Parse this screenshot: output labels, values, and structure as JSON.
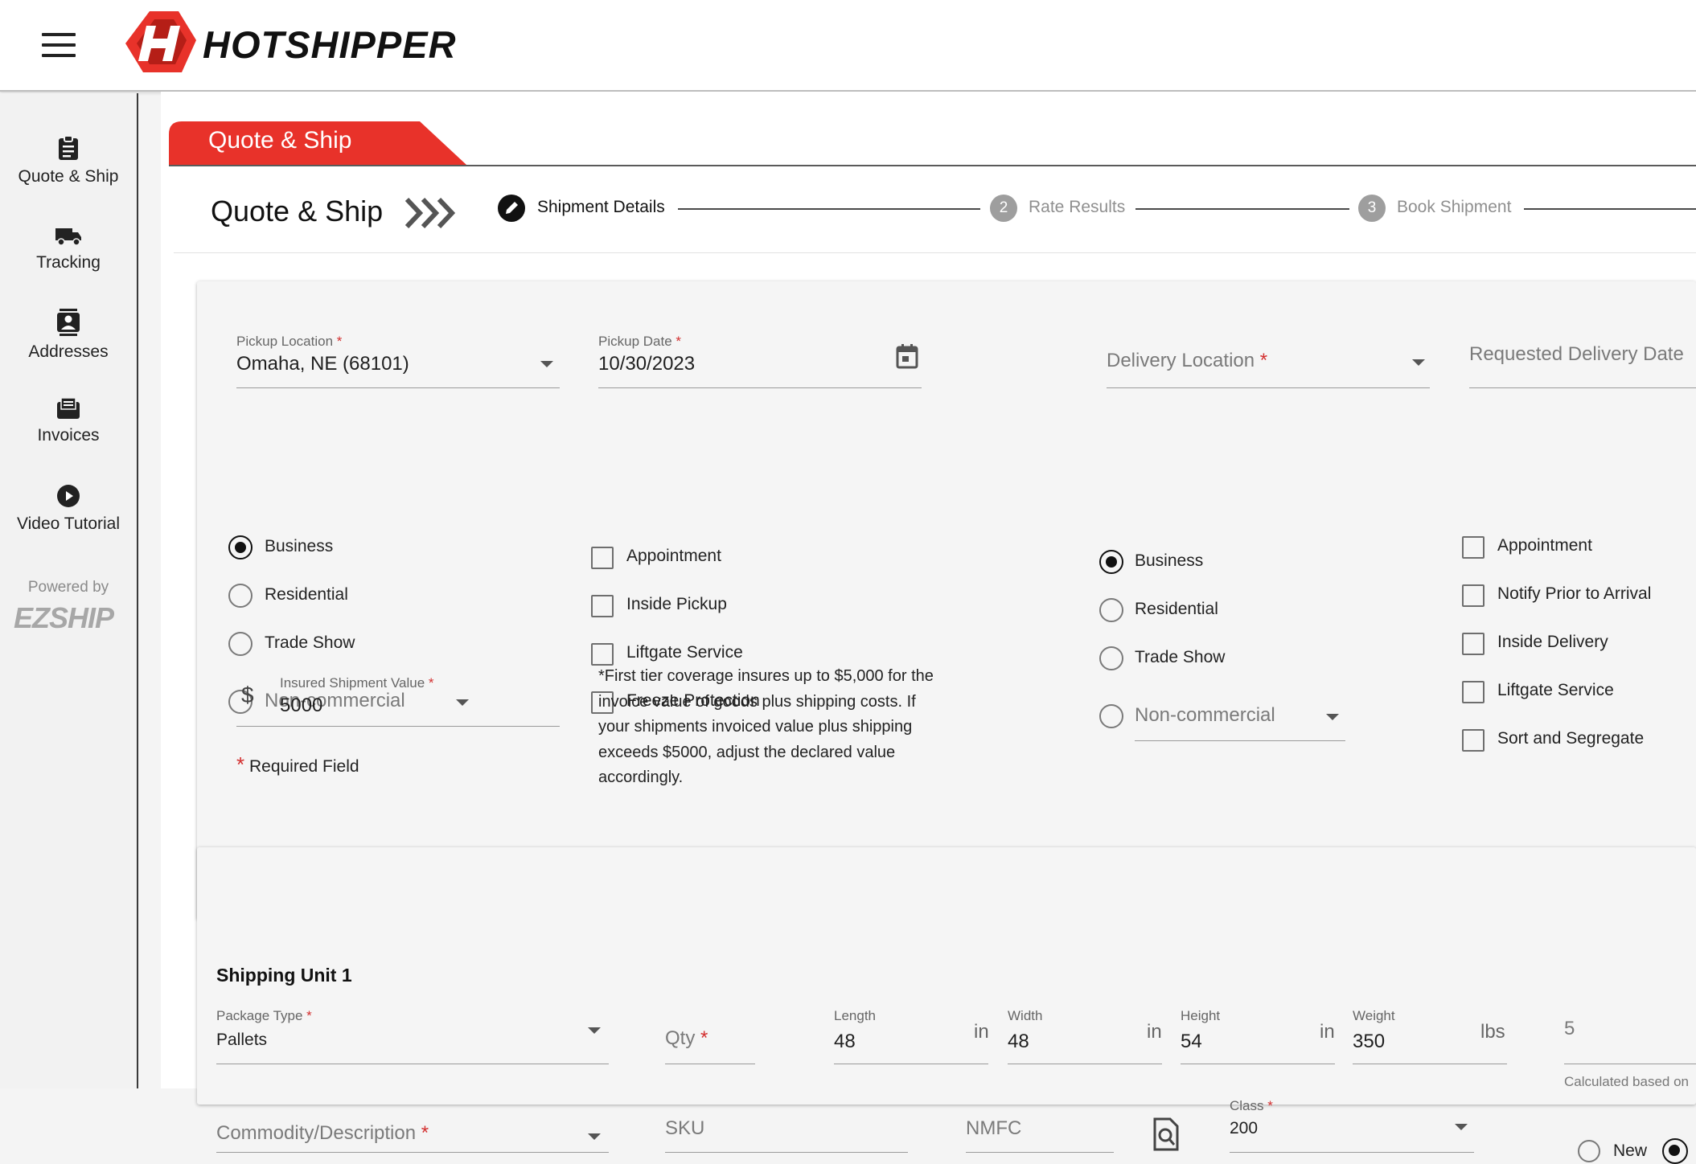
{
  "brand": {
    "name": "HOTSHIPPER",
    "powered_by": "Powered by",
    "partner": "EZSHIP"
  },
  "sidebar": {
    "items": [
      {
        "label": "Quote & Ship",
        "icon": "clipboard-icon"
      },
      {
        "label": "Tracking",
        "icon": "truck-icon"
      },
      {
        "label": "Addresses",
        "icon": "contacts-icon"
      },
      {
        "label": "Invoices",
        "icon": "invoice-icon"
      },
      {
        "label": "Video Tutorial",
        "icon": "play-icon"
      }
    ]
  },
  "tab": {
    "label": "Quote & Ship"
  },
  "page": {
    "title": "Quote & Ship"
  },
  "stepper": {
    "steps": [
      {
        "number": "",
        "label": "Shipment Details",
        "state": "active"
      },
      {
        "number": "2",
        "label": "Rate Results",
        "state": "inactive"
      },
      {
        "number": "3",
        "label": "Book Shipment",
        "state": "inactive"
      }
    ]
  },
  "pickup": {
    "location": {
      "label": "Pickup Location",
      "value": "Omaha, NE (68101)"
    },
    "date": {
      "label": "Pickup Date",
      "value": "10/30/2023"
    },
    "types": [
      "Business",
      "Residential",
      "Trade Show"
    ],
    "selected_type": "Business",
    "non_commercial": "Non-commercial",
    "services": [
      "Appointment",
      "Inside Pickup",
      "Liftgate Service",
      "Freeze Protection"
    ],
    "insured": {
      "label": "Insured Shipment Value",
      "prefix": "$",
      "value": "5000"
    },
    "required_note": "Required Field",
    "coverage_note": "*First tier coverage insures up to $5,000 for the invoice value of goods plus shipping costs. If your shipments invoiced value plus shipping exceeds $5000, adjust the declared value accordingly."
  },
  "delivery": {
    "location": {
      "placeholder": "Delivery Location"
    },
    "date": {
      "placeholder": "Requested Delivery Date"
    },
    "types": [
      "Business",
      "Residential",
      "Trade Show"
    ],
    "selected_type": "Business",
    "non_commercial": "Non-commercial",
    "services": [
      "Appointment",
      "Notify Prior to Arrival",
      "Inside Delivery",
      "Liftgate Service",
      "Sort and Segregate"
    ]
  },
  "shipping_unit": {
    "title": "Shipping Unit 1",
    "package_type": {
      "label": "Package Type",
      "value": "Pallets"
    },
    "qty": {
      "placeholder": "Qty"
    },
    "length": {
      "label": "Length",
      "value": "48",
      "unit": "in"
    },
    "width": {
      "label": "Width",
      "value": "48",
      "unit": "in"
    },
    "height": {
      "label": "Height",
      "value": "54",
      "unit": "in"
    },
    "weight": {
      "label": "Weight",
      "value": "350",
      "unit": "lbs"
    },
    "calc": {
      "value": "5",
      "hint": "Calculated based on"
    },
    "commodity": {
      "placeholder": "Commodity/Description"
    },
    "sku": {
      "placeholder": "SKU"
    },
    "nmfc": {
      "placeholder": "NMFC"
    },
    "class": {
      "label": "Class",
      "value": "200"
    },
    "condition": {
      "options": [
        "New"
      ],
      "selected": "second"
    }
  },
  "colors": {
    "brand_red": "#e8322a",
    "active_step": "#111111",
    "inactive_step": "#9e9e9e"
  }
}
